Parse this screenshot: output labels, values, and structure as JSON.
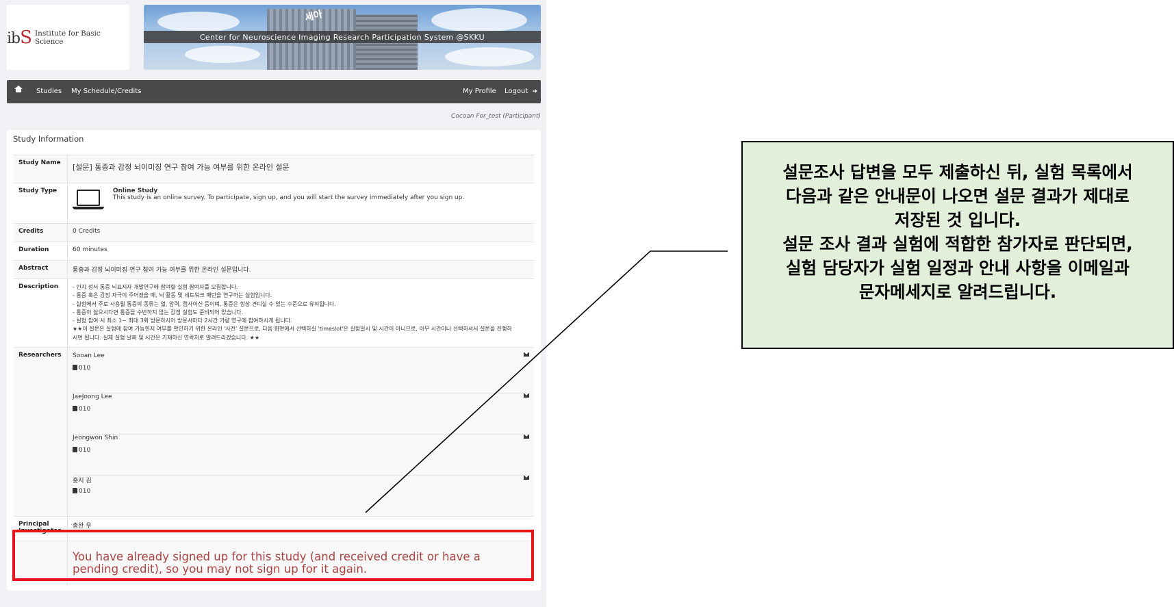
{
  "header": {
    "logo_mark": "ibS",
    "logo_text": "Institute for Basic Science",
    "banner_sign": "세아",
    "banner_title": "Center for Neuroscience Imaging Research Participation System @SKKU"
  },
  "nav": {
    "items": [
      "Studies",
      "My Schedule/Credits"
    ],
    "profile": "My Profile",
    "logout": "Logout"
  },
  "user_line": "Cocoan For_test (Participant)",
  "panel_title": "Study Information",
  "study": {
    "name_label": "Study Name",
    "name": "[설문] 통증과 감정 뇌이미징 연구 참여 가능 여부를 위한 온라인 설문",
    "type_label": "Study Type",
    "type_name": "Online Study",
    "type_desc": "This study is an online survey. To participate, sign up, and you will start the survey immediately after you sign up.",
    "credits_label": "Credits",
    "credits": "0 Credits",
    "duration_label": "Duration",
    "duration": "60 minutes",
    "abstract_label": "Abstract",
    "abstract": "통증과 감정 뇌이미징 연구 참여 가능 여부를 위한 온라인 설문입니다.",
    "description_label": "Description",
    "description": [
      "- 인지 정서 통증 뇌표지자 개발연구에 참여할 실험 참여자를 모집합니다.",
      "- 통증 혹은 감정 자극이 주어졌을 때, 뇌 활동 및 네트워크 패턴을 연구하는 실험입니다.",
      "- 실험에서 주로 사용될 통증의 종류는 열, 압력, 캡사이신 등이며, 통증은 항상 견디실 수 있는 수준으로 유지됩니다.",
      "- 통증이 싫으시다면 통증을 수반하지 않는 감정 실험도 준비되어 있습니다.",
      "- 실험 참여 시 최소 1~ 최대 3회 방문하시어 방문시마다 2시간 가량 연구에 참여하시게 됩니다.",
      "★★이 설문은 실험에 참여 가능한지 여부를 확인하기 위한 온라인 '사전' 설문으로, 다음 화면에서 선택하실 'timeslot'은 실험일시 및 시간이 아니므로, 아무 시간이나 선택하셔서 설문을 진행하",
      "시면 됩니다. 실제 실험 날짜 및 시간은 기재하신 연락처로 알려드리겠습니다. ★★"
    ],
    "researchers_label": "Researchers",
    "researchers": [
      {
        "name": "Sooan Lee",
        "phone": "010"
      },
      {
        "name": "JaeJoong Lee",
        "phone": "010"
      },
      {
        "name": "Jeongwon Shin",
        "phone": "010"
      },
      {
        "name": "홍지 김",
        "phone": "010"
      }
    ],
    "pi_label": "Principal Investigator",
    "pi": "총완 우",
    "warning": "You have already signed up for this study (and received credit or have a pending credit), so you may not sign up for it again."
  },
  "annotation": {
    "lines": [
      "설문조사 답변을 모두 제출하신 뒤, 실험 목록에서",
      "다음과 같은 안내문이 나오면 설문 결과가 제대로",
      "저장된 것 입니다.",
      "설문 조사 결과 실험에 적합한 참가자로 판단되면,",
      "실험 담당자가 실험 일정과 안내 사항을 이메일과",
      "문자메세지로 알려드립니다."
    ]
  },
  "colors": {
    "navbar": "#4a4a4a",
    "warning_text": "#a94442",
    "highlight_border": "#e8141b",
    "annotation_bg": "#e2efda"
  }
}
